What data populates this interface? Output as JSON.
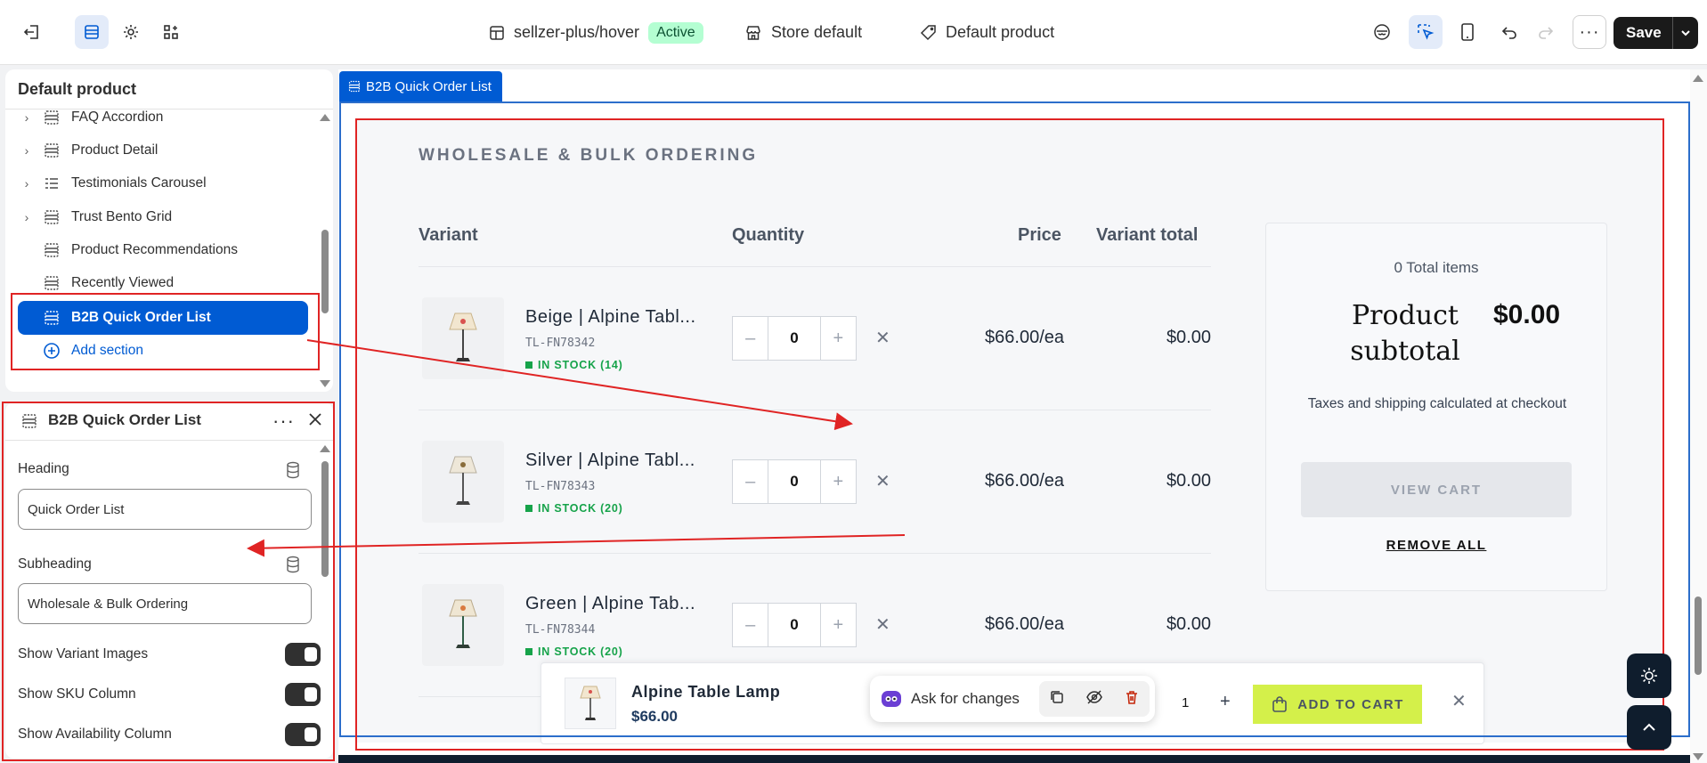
{
  "topbar": {
    "store_theme": "sellzer-plus/hover",
    "status_badge": "Active",
    "market": "Store default",
    "template": "Default product",
    "save_label": "Save"
  },
  "sections_panel": {
    "title": "Default product",
    "items": [
      {
        "label": "FAQ Accordion",
        "expandable": true
      },
      {
        "label": "Product Detail",
        "expandable": true
      },
      {
        "label": "Testimonials Carousel",
        "expandable": true
      },
      {
        "label": "Trust Bento Grid",
        "expandable": true
      },
      {
        "label": "Product Recommendations",
        "expandable": false
      },
      {
        "label": "Recently Viewed",
        "expandable": false
      },
      {
        "label": "B2B Quick Order List",
        "expandable": false,
        "selected": true
      }
    ],
    "add_section": "Add section"
  },
  "settings_panel": {
    "title": "B2B Quick Order List",
    "heading_label": "Heading",
    "heading_value": "Quick Order List",
    "subheading_label": "Subheading",
    "subheading_value": "Wholesale & Bulk Ordering",
    "toggles": [
      {
        "label": "Show Variant Images",
        "on": true
      },
      {
        "label": "Show SKU Column",
        "on": true
      },
      {
        "label": "Show Availability Column",
        "on": true
      }
    ]
  },
  "preview": {
    "section_tag": "B2B Quick Order List",
    "heading": "WHOLESALE & BULK ORDERING",
    "columns": {
      "variant": "Variant",
      "quantity": "Quantity",
      "price": "Price",
      "variant_total": "Variant total"
    },
    "rows": [
      {
        "name": "Beige  |  Alpine Tabl...",
        "sku": "TL-FN78342",
        "stock": "IN STOCK (14)",
        "qty": "0",
        "price": "$66.00/ea",
        "total": "$0.00"
      },
      {
        "name": "Silver  |  Alpine Tabl...",
        "sku": "TL-FN78343",
        "stock": "IN STOCK (20)",
        "qty": "0",
        "price": "$66.00/ea",
        "total": "$0.00"
      },
      {
        "name": "Green  |  Alpine Tab...",
        "sku": "TL-FN78344",
        "stock": "IN STOCK (20)",
        "qty": "0",
        "price": "$66.00/ea",
        "total": "$0.00"
      }
    ],
    "summary": {
      "total_items": "0 Total items",
      "subtotal_label": "Product subtotal",
      "subtotal_value": "$0.00",
      "taxes_note": "Taxes and shipping calculated at checkout",
      "view_cart": "VIEW CART",
      "remove_all": "REMOVE ALL"
    },
    "sticky": {
      "product_name": "Alpine Table Lamp",
      "product_price": "$66.00",
      "qty": "1",
      "add_to_cart": "ADD TO CART"
    },
    "ask_changes": "Ask for changes"
  },
  "colors": {
    "accent_blue": "#005bd3",
    "annotation_red": "#e02424",
    "stock_green": "#16a34a",
    "add_to_cart_lime": "#d4f04a"
  }
}
